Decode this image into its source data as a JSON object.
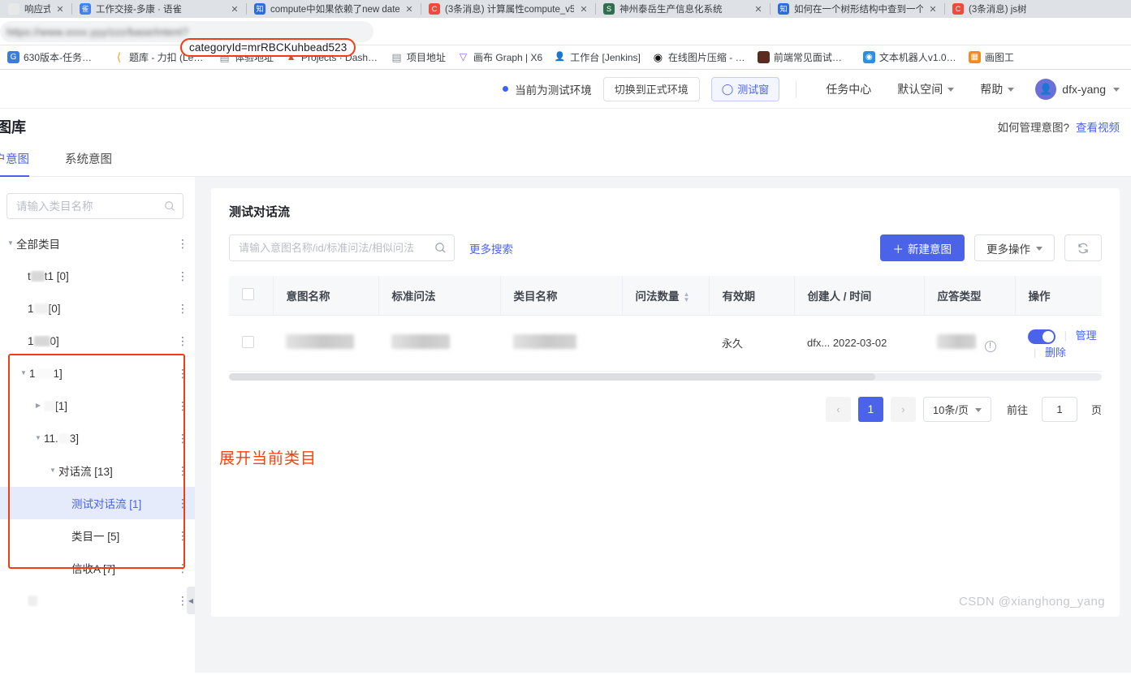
{
  "browser": {
    "tabs": [
      {
        "title": "响应式布",
        "favicon_color": "#e8e8e8",
        "favicon_glyph": "",
        "close": "✕"
      },
      {
        "title": "工作交接-多康 · 语雀",
        "favicon_color": "#3b82f6",
        "favicon_glyph": "雀",
        "close": "✕"
      },
      {
        "title": "compute中如果依赖了new date",
        "favicon_color": "#2d6cdf",
        "favicon_glyph": "C",
        "close": "✕"
      },
      {
        "title": "(3条消息) 计算属性compute_v5",
        "favicon_color": "#f04a3c",
        "favicon_glyph": "C",
        "close": "✕"
      },
      {
        "title": "神州泰岳生产信息化系统",
        "favicon_color": "#2f6f4f",
        "favicon_glyph": "S",
        "close": "✕"
      },
      {
        "title": "如何在一个树形结构中查到一个节",
        "favicon_color": "#2d6cdf",
        "favicon_glyph": "知",
        "close": "✕"
      },
      {
        "title": "(3条消息) js树",
        "favicon_color": "#f04a3c",
        "favicon_glyph": "C",
        "close": "✕"
      }
    ],
    "url_blurred": "https://www.xxxx.yyy/zzz/base/intent?",
    "url_highlight": "categoryId=mrRBCKuhbead523",
    "bookmarks": [
      {
        "label": "630版本-任务列表...",
        "color": "#3b7ddd",
        "glyph": "G"
      },
      {
        "label": "题库 - 力扣 (LeetC...",
        "color": "#ffffff",
        "glyph": "⟨"
      },
      {
        "label": "体验地址",
        "color": "#ffffff",
        "glyph": "▤"
      },
      {
        "label": "Projects · Dashbo...",
        "color": "#ffffff",
        "glyph": "🦊"
      },
      {
        "label": "项目地址",
        "color": "#ffffff",
        "glyph": "▤"
      },
      {
        "label": "画布 Graph | X6",
        "color": "#ffffff",
        "glyph": "▽"
      },
      {
        "label": "工作台 [Jenkins]",
        "color": "#ffffff",
        "glyph": "👨"
      },
      {
        "label": "在线图片压缩 - do...",
        "color": "#111111",
        "glyph": "◉"
      },
      {
        "label": "前端常见面试题总结",
        "color": "#5a2b1e",
        "glyph": "▦"
      },
      {
        "label": "文本机器人v1.0第...",
        "color": "#2d8fe0",
        "glyph": "⬤"
      },
      {
        "label": "画图工",
        "color": "#f08a24",
        "glyph": "◳"
      }
    ]
  },
  "app_header": {
    "env_label": "当前为测试环境",
    "switch_env_button": "切换到正式环境",
    "test_window_button": "测试窗",
    "test_window_icon": "chat-icon",
    "task_center": "任务中心",
    "workspace": "默认空间",
    "help": "帮助",
    "user_name": "dfx-yang",
    "accent_color": "#4a63e8"
  },
  "page": {
    "title": "意图库",
    "help_question": "如何管理意图?",
    "help_link": "查看视频",
    "tabs": [
      {
        "label": "用户意图",
        "active": true
      },
      {
        "label": "系统意图",
        "active": false
      }
    ]
  },
  "tree": {
    "search_placeholder": "请输入类目名称",
    "search_value": "",
    "nodes": [
      {
        "label": "全部类目",
        "indent": 0,
        "arrow": "open",
        "redacted": false,
        "selected": false
      },
      {
        "label": "test1 [0]",
        "indent": 1,
        "arrow": "none",
        "redacted": true,
        "selected": false
      },
      {
        "label": "1 [0]",
        "indent": 1,
        "arrow": "none",
        "redacted": true,
        "selected": false
      },
      {
        "label": "1 0]",
        "indent": 1,
        "arrow": "none",
        "redacted": true,
        "selected": false
      },
      {
        "label": "1 1]",
        "indent": 1,
        "arrow": "open",
        "redacted": true,
        "selected": false
      },
      {
        "label": "[1]",
        "indent": 2,
        "arrow": "closed",
        "redacted": true,
        "selected": false
      },
      {
        "label": "11. 3]",
        "indent": 2,
        "arrow": "open",
        "redacted": true,
        "selected": false
      },
      {
        "label": "对话流 [13]",
        "indent": 3,
        "arrow": "open",
        "redacted": false,
        "selected": false
      },
      {
        "label": "测试对话流 [1]",
        "indent": 4,
        "arrow": "none",
        "redacted": false,
        "selected": true
      },
      {
        "label": "类目一 [5]",
        "indent": 4,
        "arrow": "none",
        "redacted": false,
        "selected": false
      },
      {
        "label": "信收A [7]",
        "indent": 4,
        "arrow": "none",
        "redacted": false,
        "selected": false
      },
      {
        "label": "",
        "indent": 2,
        "arrow": "none",
        "redacted": true,
        "selected": false
      }
    ],
    "menu_icon": "kebab-menu-icon",
    "highlight_color": "#f23c13"
  },
  "main": {
    "card_title": "测试对话流",
    "search_placeholder": "请输入意图名称/id/标准问法/相似问法",
    "search_value": "",
    "more_search": "更多搜索",
    "new_intent_button": "新建意图",
    "new_intent_plus": "＋",
    "more_actions_button": "更多操作",
    "refresh_icon": "refresh-icon",
    "table": {
      "columns": [
        {
          "label": "",
          "key": "checkbox"
        },
        {
          "label": "意图名称",
          "key": "name"
        },
        {
          "label": "标准问法",
          "key": "standard"
        },
        {
          "label": "类目名称",
          "key": "category"
        },
        {
          "label": "问法数量",
          "key": "count",
          "sortable": true
        },
        {
          "label": "有效期",
          "key": "validity"
        },
        {
          "label": "创建人 / 时间",
          "key": "creator"
        },
        {
          "label": "应答类型",
          "key": "reply_type"
        },
        {
          "label": "操作",
          "key": "ops"
        }
      ],
      "rows": [
        {
          "name": "",
          "standard": "",
          "category": "",
          "count": "",
          "validity": "永久",
          "creator": "dfx...",
          "created_time": "2022-03-02",
          "reply_type": "",
          "toggle_on": true,
          "ops": [
            "管理",
            "删除"
          ]
        }
      ]
    },
    "pagination": {
      "prev": "‹",
      "next": "›",
      "current_page": "1",
      "page_size": "10条/页",
      "jump_prefix": "前往",
      "jump_value": "1",
      "jump_suffix": "页"
    }
  },
  "annotation": {
    "text": "展开当前类目",
    "color": "#f8400c"
  },
  "watermark": "CSDN @xianghong_yang"
}
